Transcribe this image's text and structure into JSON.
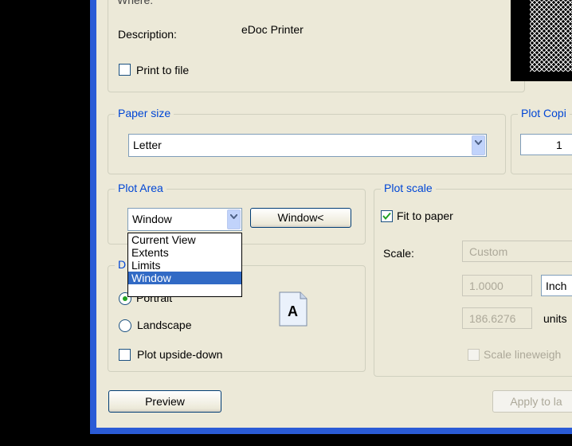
{
  "printer": {
    "clipped_label": "Where:",
    "description_label": "Description:",
    "description_value": "eDoc Printer",
    "print_to_file_label": "Print to file",
    "print_to_file_checked": false
  },
  "paper_size": {
    "legend": "Paper size",
    "selected": "Letter"
  },
  "plot_copies": {
    "legend": "Plot Copi",
    "value": "1"
  },
  "plot_area": {
    "legend": "Plot Area",
    "selected": "Window",
    "window_button_label": "Window<",
    "options": [
      "Current View",
      "Extents",
      "Limits",
      "Window"
    ],
    "highlighted_option": "Window"
  },
  "drawing_orientation": {
    "legend": "D",
    "portrait_label": "Portrait",
    "landscape_label": "Landscape",
    "upside_down_label": "Plot upside-down",
    "selected": "Portrait",
    "upside_down_checked": false,
    "page_icon_letter": "A"
  },
  "plot_scale": {
    "legend": "Plot scale",
    "fit_to_paper_label": "Fit to paper",
    "fit_to_paper_checked": true,
    "scale_label": "Scale:",
    "scale_value": "Custom",
    "numerator": "1.0000",
    "units_unit": "Inch",
    "denominator": "186.6276",
    "units_label": "units",
    "scale_lineweights_label": "Scale lineweigh",
    "scale_lineweights_checked": false
  },
  "footer": {
    "preview_label": "Preview",
    "apply_label": "Apply to la"
  },
  "colors": {
    "legend_text": "#0046d5",
    "selection": "#316ac5",
    "window_border": "#2a5bd6",
    "dialog_bg": "#ece9d8"
  }
}
